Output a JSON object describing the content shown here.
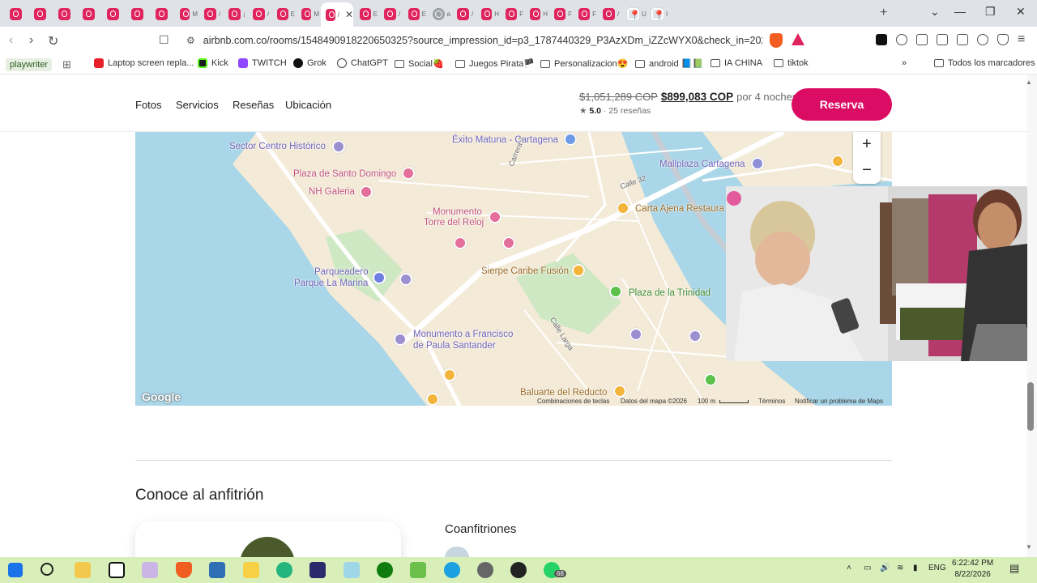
{
  "browser": {
    "tabs": [
      {
        "icon": "airbnb-icon",
        "tail": ""
      },
      {
        "icon": "airbnb-icon",
        "tail": ""
      },
      {
        "icon": "airbnb-icon",
        "tail": ""
      },
      {
        "icon": "airbnb-icon",
        "tail": ""
      },
      {
        "icon": "airbnb-icon",
        "tail": ""
      },
      {
        "icon": "airbnb-icon",
        "tail": ""
      },
      {
        "icon": "airbnb-icon",
        "tail": ""
      },
      {
        "icon": "airbnb-icon",
        "tail": "M"
      },
      {
        "icon": "airbnb-icon",
        "tail": "/"
      },
      {
        "icon": "airbnb-icon",
        "tail": "¡"
      },
      {
        "icon": "airbnb-icon",
        "tail": "/"
      },
      {
        "icon": "airbnb-icon",
        "tail": "E"
      },
      {
        "icon": "airbnb-icon",
        "tail": "M"
      },
      {
        "icon": "airbnb-icon",
        "tail": "/",
        "active": true
      },
      {
        "icon": "airbnb-icon",
        "tail": "E"
      },
      {
        "icon": "airbnb-icon",
        "tail": "/"
      },
      {
        "icon": "airbnb-icon",
        "tail": "E"
      },
      {
        "icon": "globe-icon",
        "tail": "a"
      },
      {
        "icon": "airbnb-icon",
        "tail": "/"
      },
      {
        "icon": "airbnb-icon",
        "tail": "H"
      },
      {
        "icon": "airbnb-icon",
        "tail": "F"
      },
      {
        "icon": "airbnb-icon",
        "tail": "H"
      },
      {
        "icon": "airbnb-icon",
        "tail": "F"
      },
      {
        "icon": "airbnb-icon",
        "tail": "F"
      },
      {
        "icon": "airbnb-icon",
        "tail": "/"
      },
      {
        "icon": "maps-icon",
        "tail": "U"
      },
      {
        "icon": "maps-icon",
        "tail": "I"
      }
    ],
    "new_tab": "+",
    "window_controls": {
      "list": "⌄",
      "minimize": "—",
      "maximize": "❐",
      "close": "✕"
    },
    "url": "airbnb.com.co/rooms/1548490918220650325?source_impression_id=p3_1787440329_P3AzXDm_iZZcWYX0&check_in=2026-08-2..."
  },
  "bookmarks": [
    {
      "label": "playwriter",
      "type": "pill"
    },
    {
      "label": "",
      "type": "apps"
    },
    {
      "label": "Laptop screen repla...",
      "type": "youtube"
    },
    {
      "label": "Kick",
      "type": "kick"
    },
    {
      "label": "TWITCH",
      "type": "twitch"
    },
    {
      "label": "Grok",
      "type": "grok"
    },
    {
      "label": "ChatGPT",
      "type": "chatgpt"
    },
    {
      "label": "Social🍓",
      "type": "folder"
    },
    {
      "label": "Juegos Pirata🏴",
      "type": "folder"
    },
    {
      "label": "Personalizacion😍",
      "type": "folder"
    },
    {
      "label": "android 📘📗",
      "type": "folder"
    },
    {
      "label": "IA CHINA",
      "type": "folder"
    },
    {
      "label": "tiktok",
      "type": "folder"
    }
  ],
  "bookmarks_overflow": "»",
  "bookmarks_all": "Todos los marcadores",
  "listing_nav": {
    "links": [
      "Fotos",
      "Servicios",
      "Reseñas",
      "Ubicación"
    ],
    "old_price": "$1,051,289 COP",
    "new_price": "$899,083 COP",
    "nights": "por 4 noches",
    "rating": "5.0",
    "reviews": "· 25 reseñas",
    "reserve_label": "Reserva"
  },
  "map": {
    "zoom_in": "+",
    "zoom_out": "−",
    "pois": [
      {
        "label": "Sector Centro Histórico",
        "color": "blue"
      },
      {
        "label": "Éxito Matuna - Cartagena",
        "color": "blue"
      },
      {
        "label": "Mallplaza Cartagena",
        "color": "blue"
      },
      {
        "label": "Plaza de Santo Domingo",
        "color": "pink"
      },
      {
        "label": "NH Galeria",
        "color": "pink"
      },
      {
        "label": "Carta Ajena Restaura",
        "color": "brown"
      },
      {
        "label": "Monumento",
        "color": "pink"
      },
      {
        "label": "Torre del Reloj",
        "color": "pink"
      },
      {
        "label": "Parqueadero",
        "color": "blue"
      },
      {
        "label": "Parque La Marina",
        "color": "blue"
      },
      {
        "label": "Sierpe Caribe Fusión",
        "color": "brown"
      },
      {
        "label": "Plaza de la Trinidad",
        "color": "green"
      },
      {
        "label": "Monumento a Francisco",
        "color": "blue"
      },
      {
        "label": "de Paula Santander",
        "color": "blue"
      },
      {
        "label": "Baluarte del Reducto",
        "color": "brown"
      }
    ],
    "streets": [
      "Carrera 7",
      "Calle 32",
      "Calle Larga"
    ],
    "attribution": {
      "logo": "Google",
      "shortcuts": "Combinaciones de teclas",
      "data": "Datos del mapa ©2026",
      "scale": "100 m",
      "terms": "Términos",
      "report": "Notificar un problema de Maps"
    }
  },
  "host": {
    "title": "Conoce al anfitrión",
    "cohosts_label": "Coanfitriones"
  },
  "taskbar": {
    "apps": [
      "windows-icon",
      "search-icon",
      "file-explorer-icon",
      "notion-icon",
      "app-icon",
      "brave-icon",
      "store-icon",
      "sticky-notes-icon",
      "edge-icon",
      "sh-icon",
      "app-a-icon",
      "xbox-icon",
      "app-green-icon",
      "refresh-app-icon",
      "settings-icon",
      "recorder-icon",
      "whatsapp-icon"
    ],
    "whatsapp_badge": "68",
    "lang": "ENG",
    "time": "6:22:42 PM",
    "date": "8/22/2026"
  }
}
